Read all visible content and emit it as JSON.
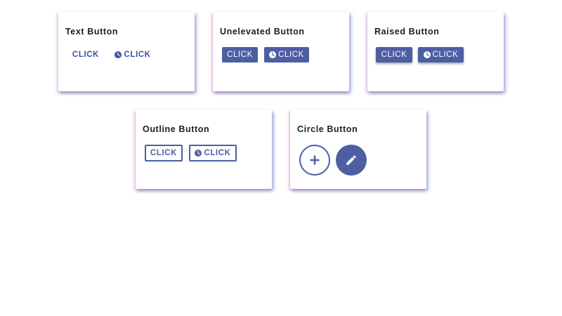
{
  "colors": {
    "accent": "#4d5ea3",
    "text_button": "#3f51a0",
    "title": "#1e1e1e"
  },
  "cards": {
    "text": {
      "title": "Text Button",
      "button1_label": "CLICK",
      "button2_label": "CLICK",
      "button2_icon": "clock-icon"
    },
    "unelevated": {
      "title": "Unelevated Button",
      "button1_label": "CLICK",
      "button2_label": "CLICK",
      "button2_icon": "clock-icon"
    },
    "raised": {
      "title": "Raised Button",
      "button1_label": "CLICK",
      "button2_label": "CLICK",
      "button2_icon": "clock-icon"
    },
    "outline": {
      "title": "Outline Button",
      "button1_label": "CLICK",
      "button2_label": "CLICK",
      "button2_icon": "clock-icon"
    },
    "circle": {
      "title": "Circle Button",
      "button1_icon": "plus-icon",
      "button2_icon": "pencil-icon"
    }
  }
}
